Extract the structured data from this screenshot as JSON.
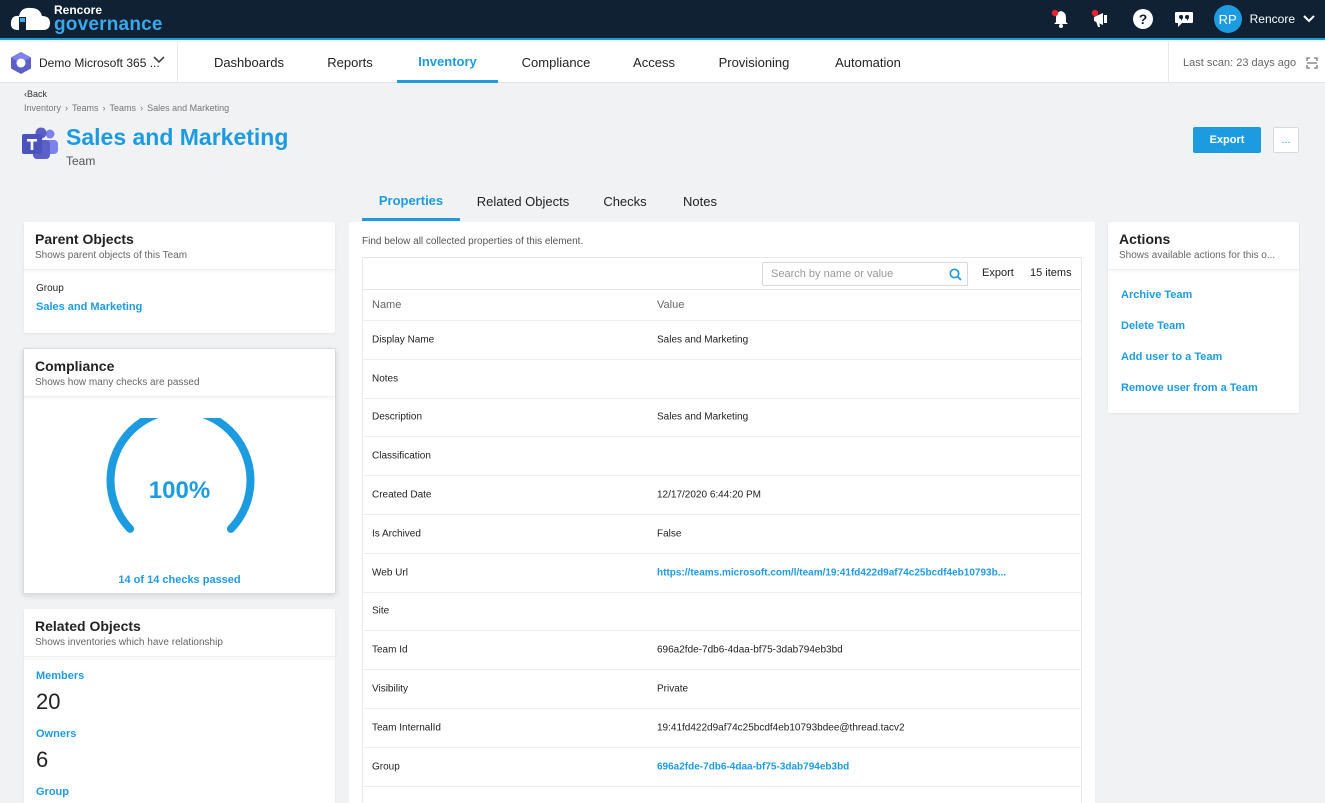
{
  "app": {
    "logo_line1": "Rencore",
    "logo_line2": "governance",
    "user_initials": "RP",
    "user_name": "Rencore"
  },
  "tenant": {
    "name": "Demo Microsoft 365 ..."
  },
  "nav": {
    "items": [
      "Dashboards",
      "Reports",
      "Inventory",
      "Compliance",
      "Access",
      "Provisioning",
      "Automation"
    ],
    "active": "Inventory",
    "last_scan": "Last scan: 23 days ago"
  },
  "header": {
    "back": "Back",
    "breadcrumb": [
      "Inventory",
      "Teams",
      "Teams",
      "Sales and Marketing"
    ],
    "title": "Sales and Marketing",
    "subtitle": "Team",
    "export_label": "Export",
    "more_label": "..."
  },
  "tabs": [
    "Properties",
    "Related Objects",
    "Checks",
    "Notes"
  ],
  "parent_objects": {
    "title": "Parent Objects",
    "subtitle": "Shows parent objects of this Team",
    "type": "Group",
    "link": "Sales and Marketing"
  },
  "compliance": {
    "title": "Compliance",
    "subtitle": "Shows how many checks are passed",
    "percent_label": "100%",
    "percent": 1.0,
    "summary": "14 of 14 checks passed"
  },
  "related_objects": {
    "title": "Related Objects",
    "subtitle": "Shows inventories which have relationship",
    "items": [
      {
        "label": "Members",
        "count": "20"
      },
      {
        "label": "Owners",
        "count": "6"
      },
      {
        "label": "Group",
        "count": ""
      }
    ]
  },
  "properties": {
    "intro": "Find below all collected properties of this element.",
    "search_placeholder": "Search by name or value",
    "export_label": "Export",
    "count": "15 items",
    "columns": [
      "Name",
      "Value"
    ],
    "rows": [
      {
        "name": "Display Name",
        "value": "Sales and Marketing",
        "link": false
      },
      {
        "name": "Notes",
        "value": "",
        "link": false
      },
      {
        "name": "Description",
        "value": "Sales and Marketing",
        "link": false
      },
      {
        "name": "Classification",
        "value": "",
        "link": false
      },
      {
        "name": "Created Date",
        "value": "12/17/2020 6:44:20 PM",
        "link": false
      },
      {
        "name": "Is Archived",
        "value": "False",
        "link": false
      },
      {
        "name": "Web Url",
        "value": "https://teams.microsoft.com/l/team/19:41fd422d9af74c25bcdf4eb10793b...",
        "link": true
      },
      {
        "name": "Site",
        "value": "",
        "link": false
      },
      {
        "name": "Team Id",
        "value": "696a2fde-7db6-4daa-bf75-3dab794eb3bd",
        "link": false
      },
      {
        "name": "Visibility",
        "value": "Private",
        "link": false
      },
      {
        "name": "Team InternalId",
        "value": "19:41fd422d9af74c25bcdf4eb10793bdee@thread.tacv2",
        "link": false
      },
      {
        "name": "Group",
        "value": "696a2fde-7db6-4daa-bf75-3dab794eb3bd",
        "link": true
      }
    ]
  },
  "actions": {
    "title": "Actions",
    "subtitle": "Shows available actions for this o...",
    "items": [
      "Archive Team",
      "Delete Team",
      "Add user to a Team",
      "Remove user from a Team"
    ]
  },
  "colors": {
    "accent": "#1d9be0",
    "topbar": "#0f2133"
  }
}
